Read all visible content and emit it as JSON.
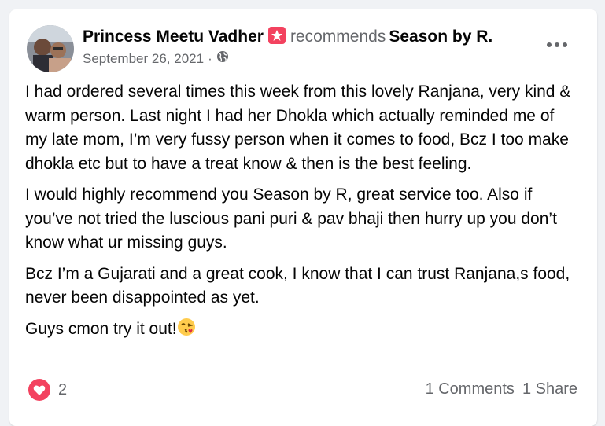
{
  "post": {
    "author": "Princess Meetu Vadher",
    "recommends_text": "recommends",
    "page_name": "Season by R.",
    "date": "September 26, 2021",
    "separator": "·",
    "audience_icon": "globe-icon",
    "paragraphs": [
      "I had ordered several times this week from this lovely Ranjana, very kind & warm person. Last night I had her Dhokla which actually reminded me of my late mom, I’m very fussy person when it comes to food, Bcz I too make dhokla etc but to have a treat  know & then is the best feeling.",
      "I would highly recommend you Season by R, great service too. Also if you’ve not tried the luscious pani puri & pav bhaji then hurry up you don’t know what ur missing guys.",
      "Bcz I’m a Gujarati and a great cook, I know that I can trust Ranjana,s food, never been disappointed as yet."
    ],
    "last_line": "Guys cmon try it out!",
    "emoji": "face-blowing-kiss-emoji",
    "reactions_count": "2",
    "comments": "1 Comments",
    "shares": "1 Share"
  },
  "colors": {
    "background": "#f0f2f5",
    "card": "#ffffff",
    "text": "#050505",
    "secondary": "#65676b",
    "love": "#f3425f",
    "badge": "#f3425f"
  }
}
